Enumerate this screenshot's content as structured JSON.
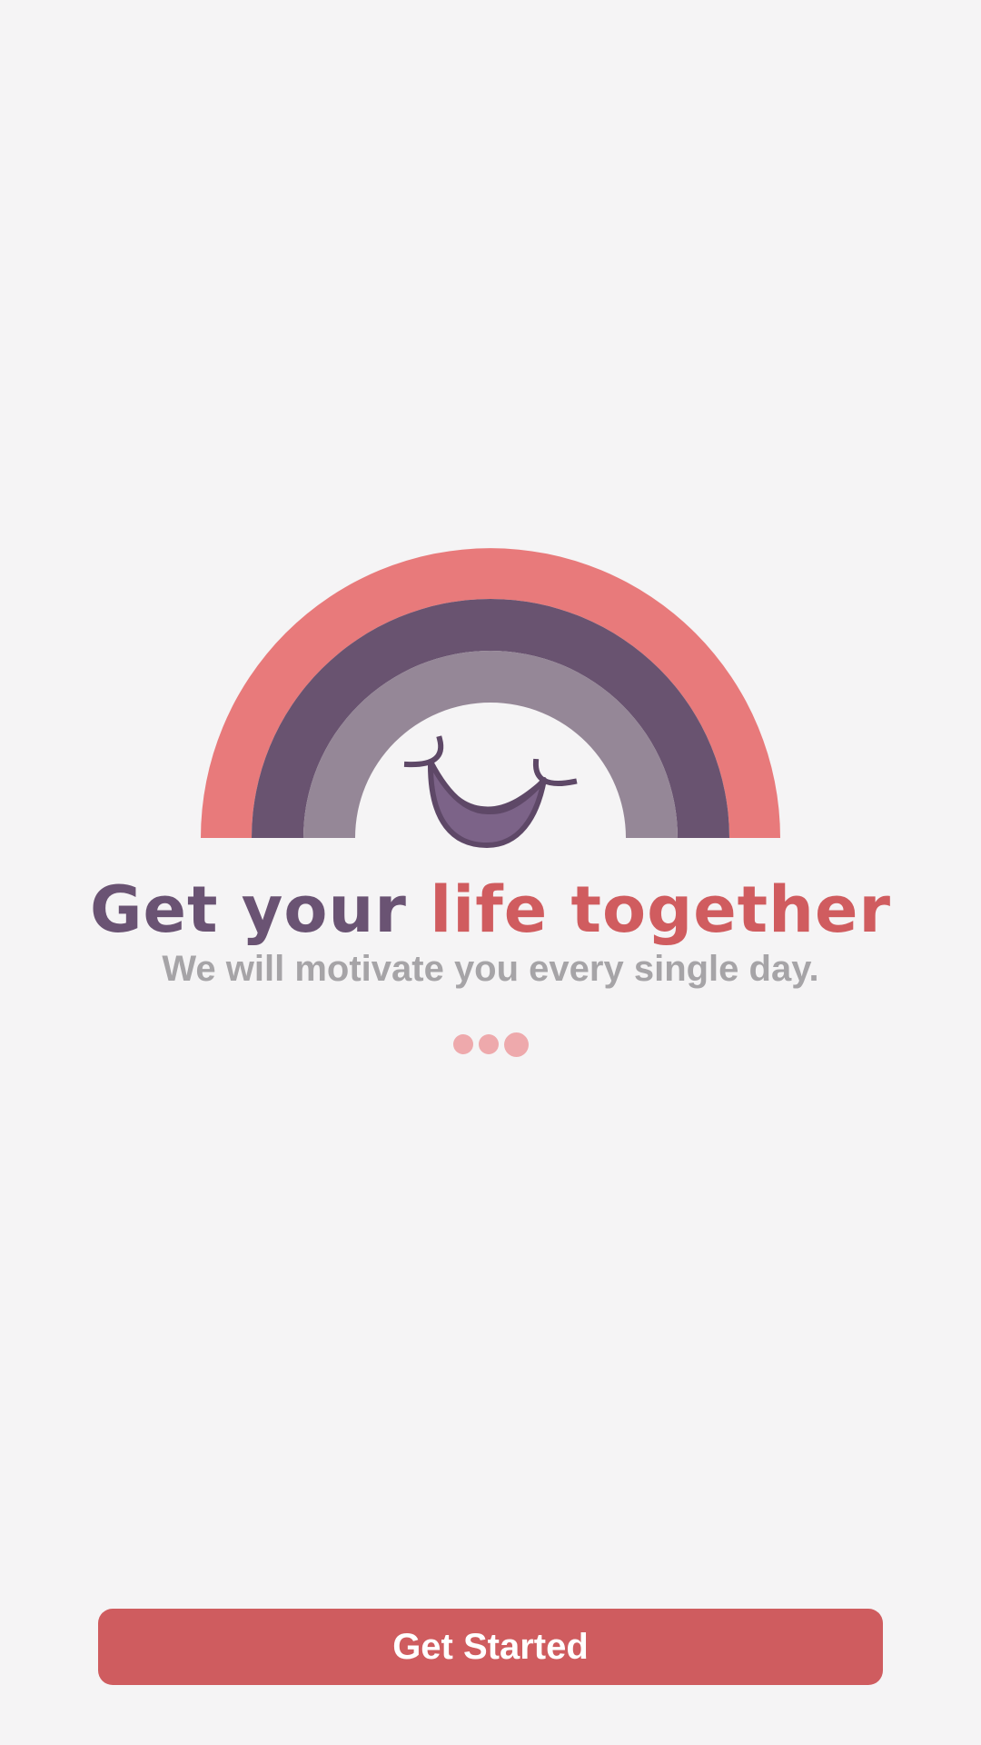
{
  "hero": {
    "title_part1": "Get your",
    "title_part2": "life together",
    "subtitle": "We will motivate you every single day."
  },
  "pager": {
    "page_count": 3,
    "active_index": 2
  },
  "cta": {
    "label": "Get Started"
  },
  "colors": {
    "background": "#f5f4f5",
    "rainbow_outer": "#e87a7b",
    "rainbow_middle": "#695370",
    "rainbow_inner": "#958797",
    "accent_red": "#cf5c5f",
    "accent_purple": "#6a5373",
    "subtitle_gray": "#a6a4a7",
    "dot_color": "#eea9ac"
  },
  "icons": {
    "illustration": "smiling-rainbow-illustration"
  }
}
